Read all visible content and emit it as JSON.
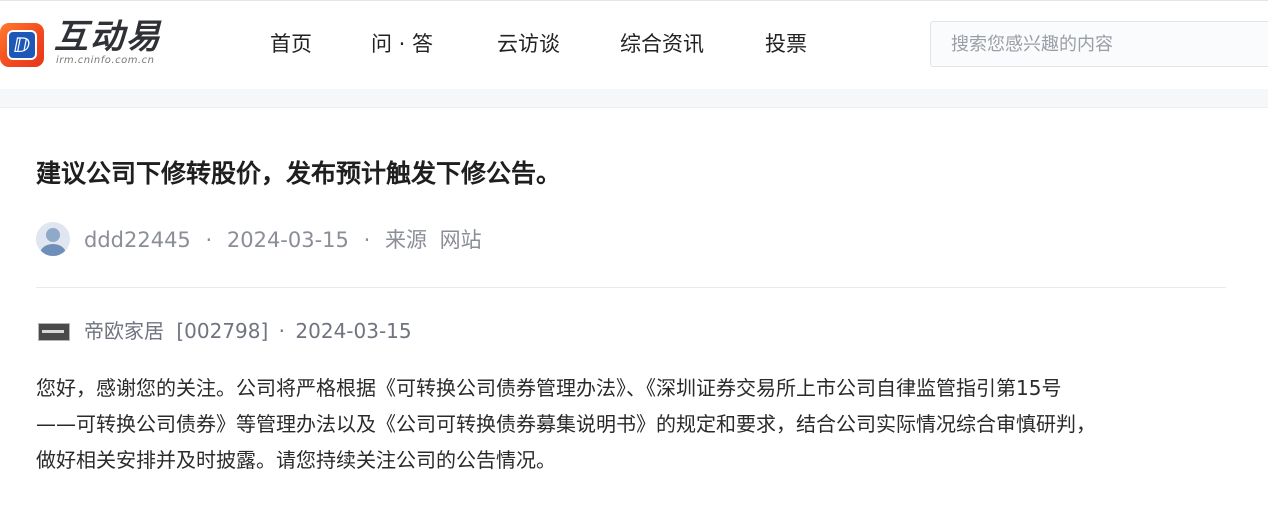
{
  "header": {
    "logo": {
      "name": "互动易",
      "url": "irm.cninfo.com.cn",
      "icon": "interactive-logo-icon"
    },
    "nav": [
      "首页",
      "问 · 答",
      "云访谈",
      "综合资讯",
      "投票"
    ],
    "search": {
      "placeholder": "搜索您感兴趣的内容",
      "value": ""
    }
  },
  "question": {
    "title": "建议公司下修转股价，发布预计触发下修公告。",
    "user": "ddd22445",
    "date": "2024-03-15",
    "source_label": "来源",
    "source": "网站",
    "separator": "·"
  },
  "answer": {
    "company": "帝欧家居",
    "code": "[002798]",
    "date": "2024-03-15",
    "lines": [
      "您好，感谢您的关注。公司将严格根据《可转换公司债券管理办法》、《深圳证券交易所上市公司自律监管指引第15号",
      "——可转换公司债券》等管理办法以及《公司可转换债券募集说明书》的规定和要求，结合公司实际情况综合审慎研判，",
      "做好相关安排并及时披露。请您持续关注公司的公告情况。"
    ]
  },
  "colors": {
    "brand_orange": "#f44a1f",
    "brand_blue": "#1d57b8",
    "meta_gray": "#8a8e96"
  }
}
